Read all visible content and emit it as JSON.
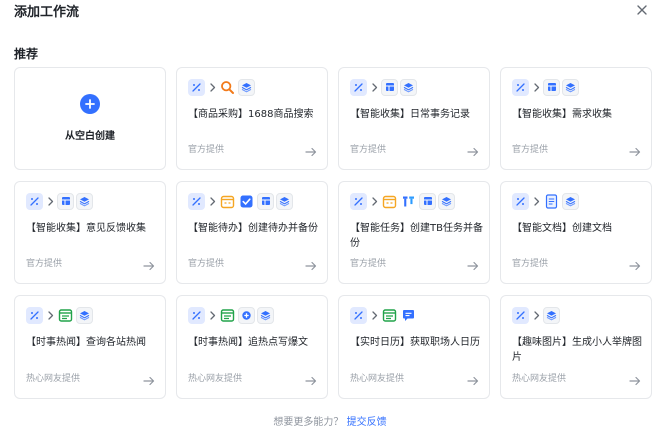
{
  "dialog": {
    "title": "添加工作流"
  },
  "section": {
    "title": "推荐"
  },
  "blank": {
    "label": "从空白创建"
  },
  "cards": [
    {
      "title": "【商品采购】1688商品搜索",
      "source": "官方提供",
      "icons": [
        "flow-icon",
        "search-icon",
        "stack-icon"
      ]
    },
    {
      "title": "【智能收集】日常事务记录",
      "source": "官方提供",
      "icons": [
        "flow-icon",
        "table-icon",
        "stack-icon"
      ]
    },
    {
      "title": "【智能收集】需求收集",
      "source": "官方提供",
      "icons": [
        "flow-icon",
        "table-icon",
        "stack-icon"
      ]
    },
    {
      "title": "【智能收集】意见反馈收集",
      "source": "官方提供",
      "icons": [
        "flow-icon",
        "table-icon",
        "stack-icon"
      ]
    },
    {
      "title": "【智能待办】创建待办并备份",
      "source": "官方提供",
      "icons": [
        "flow-icon",
        "calendar-icon",
        "checkbox-icon",
        "table-icon",
        "stack-icon"
      ]
    },
    {
      "title": "【智能任务】创建TB任务并备份",
      "source": "官方提供",
      "icons": [
        "flow-icon",
        "calendar-icon",
        "tb-icon",
        "table-icon",
        "stack-icon"
      ]
    },
    {
      "title": "【智能文档】创建文档",
      "source": "官方提供",
      "icons": [
        "flow-icon",
        "document-icon",
        "stack-icon"
      ]
    },
    {
      "title": "【时事热闻】查询各站热闻",
      "source": "热心网友提供",
      "icons": [
        "flow-icon",
        "news-icon",
        "stack-icon"
      ]
    },
    {
      "title": "【时事热闻】追热点写爆文",
      "source": "热心网友提供",
      "icons": [
        "flow-icon",
        "news-icon",
        "ai-icon",
        "stack-icon"
      ]
    },
    {
      "title": "【实时日历】获取职场人日历",
      "source": "热心网友提供",
      "icons": [
        "flow-icon",
        "news-icon",
        "chat-icon"
      ]
    },
    {
      "title": "【趣味图片】生成小人举牌图片",
      "source": "热心网友提供",
      "icons": [
        "flow-icon",
        "stack-icon"
      ]
    }
  ],
  "footer": {
    "prompt": "想要更多能力？",
    "link": "提交反馈"
  },
  "colors": {
    "accent": "#3370ff",
    "border": "#e6e8eb",
    "muted": "#9aa0a8"
  }
}
